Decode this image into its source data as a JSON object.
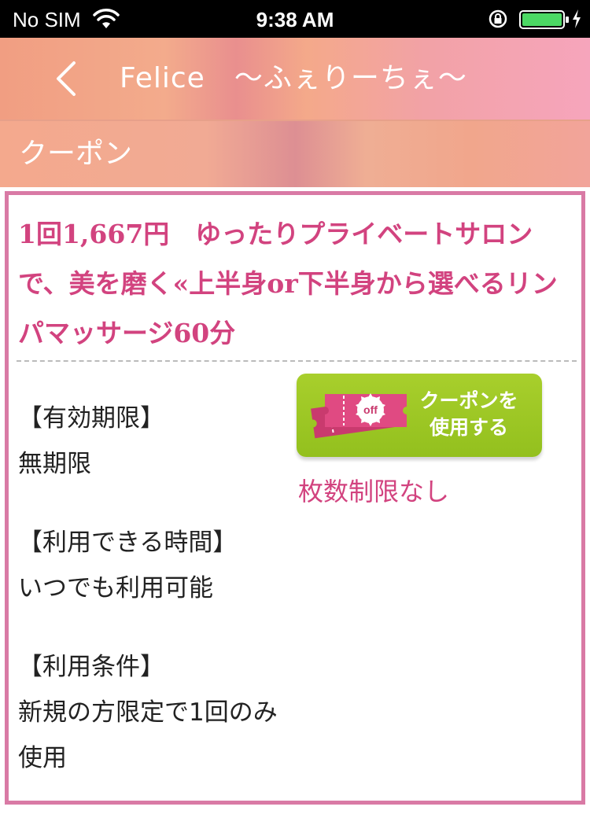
{
  "status_bar": {
    "carrier": "No SIM",
    "time": "9:38 AM",
    "battery_color": "#4cd964"
  },
  "nav": {
    "back_icon": "chevron-left-icon",
    "title": "Felice　〜ふぇりーちぇ〜"
  },
  "section": {
    "title": "クーポン"
  },
  "coupon": {
    "title": "1回1,667円　ゆったりプライベートサロンで、美を磨く«上半身or下半身から選べるリンパマッサージ60分",
    "details": [
      {
        "heading": "【有効期限】",
        "value": "無期限"
      },
      {
        "heading": "【利用できる時間】",
        "value": "いつでも利用可能"
      },
      {
        "heading": "【利用条件】",
        "value": "新規の方限定で1回のみ使用"
      }
    ],
    "use_button": {
      "line1": "クーポンを",
      "line2": "使用する",
      "ticket_text": "off",
      "icon": "coupon-ticket-icon",
      "color": "#9bc625"
    },
    "limit": "枚数制限なし"
  },
  "colors": {
    "accent": "#d2437f",
    "card_border": "#d97aa5"
  }
}
